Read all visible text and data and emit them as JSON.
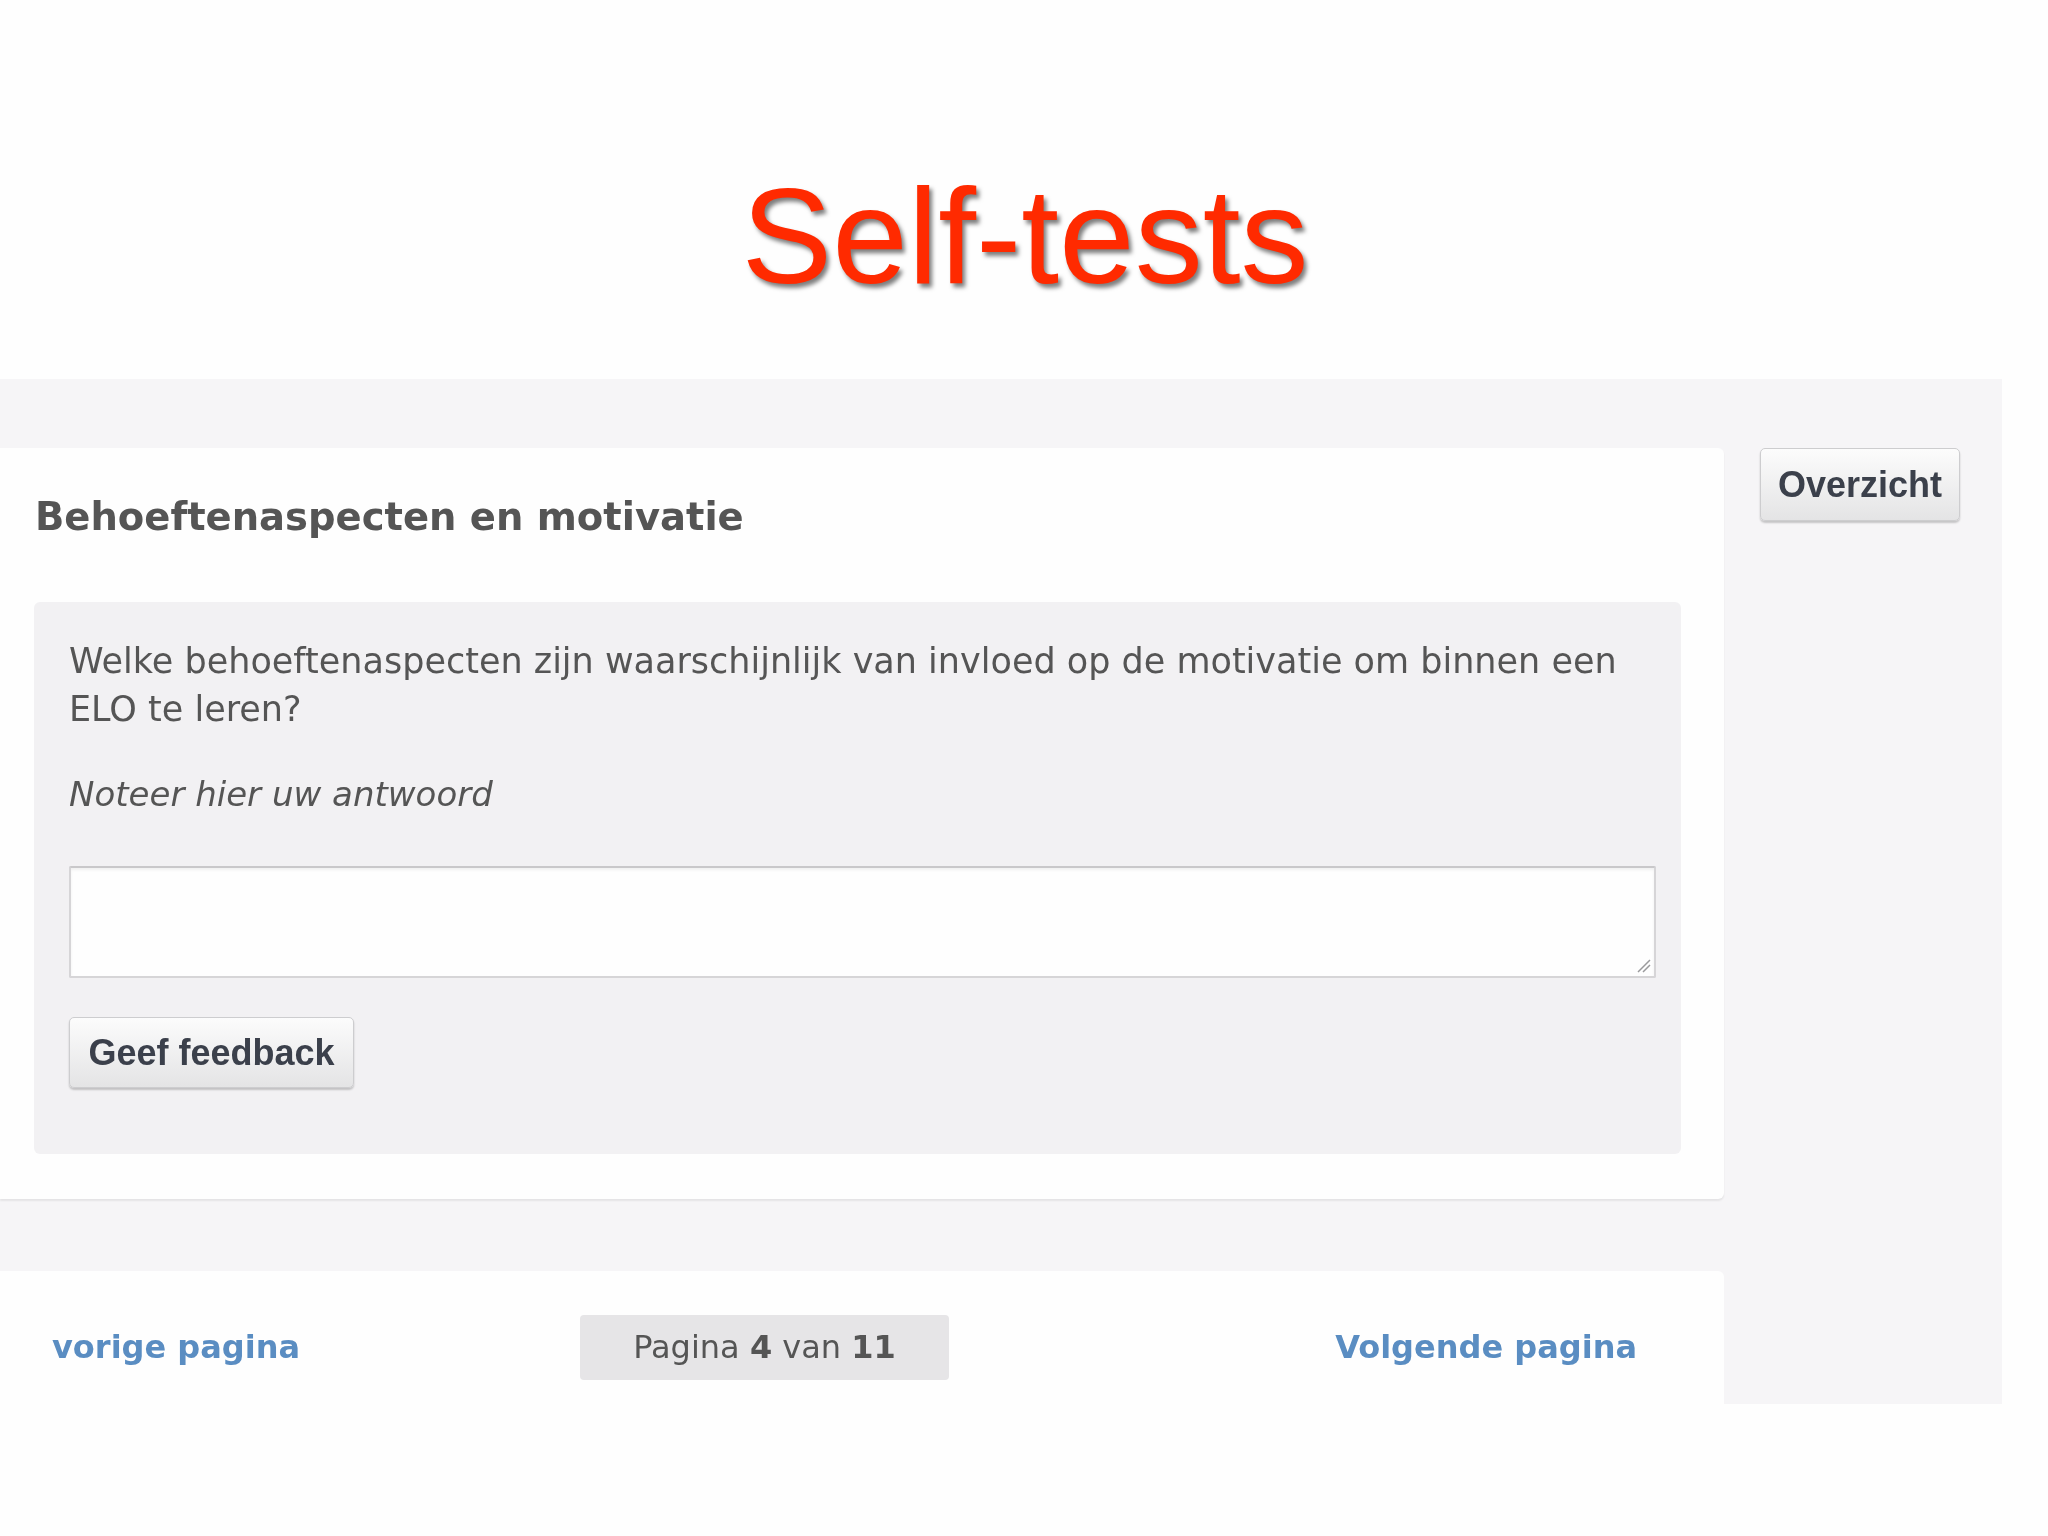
{
  "slide": {
    "title": "Self-tests"
  },
  "question_card": {
    "title": "Behoeftenaspecten en motivatie",
    "question": "Welke behoeftenaspecten zijn waarschijnlijk van invloed op de motivatie om binnen een ELO te leren?",
    "answer_prompt": "Noteer hier uw antwoord",
    "feedback_button": "Geef feedback"
  },
  "overview_button": "Overzicht",
  "pagination": {
    "previous": "vorige pagina",
    "status": "Pagina **4** van **11**",
    "next": "Volgende pagina"
  }
}
